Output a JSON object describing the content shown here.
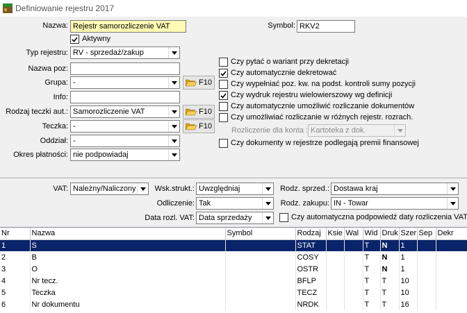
{
  "window": {
    "title": "Definiowanie rejestru 2017"
  },
  "form": {
    "nazwa_label": "Nazwa:",
    "nazwa_value": "Rejestr samorozliczenie VAT",
    "symbol_label": "Symbol:",
    "symbol_value": "RKV2",
    "aktywny_label": "Aktywny",
    "typ_label": "Typ rejestru:",
    "typ_value": "RV - sprzedaż/zakup",
    "nazwa_poz_label": "Nazwa poz:",
    "nazwa_poz_value": "",
    "grupa_label": "Grupa:",
    "grupa_value": "-",
    "info_label": "Info:",
    "info_value": "",
    "rodzaj_teczki_label": "Rodzaj teczki aut.:",
    "rodzaj_teczki_value": "Samorozliczenie VAT",
    "teczka_label": "Teczka:",
    "teczka_value": "-",
    "oddzial_label": "Oddział:",
    "oddzial_value": "-",
    "okres_label": "Okres płatności:",
    "okres_value": "nie podpowiadaj",
    "f10_label": "F10"
  },
  "options": {
    "opt1": "Czy pytać o wariant przy dekretacji",
    "opt2": "Czy automatycznie dekretować",
    "opt3": "Czy wypełniać poz. kw. na podst. kontroli sumy pozycji",
    "opt4": "Czy wydruk rejestru wielowierszowy wg definicji",
    "opt5": "Czy automatycznie umożliwić rozliczanie dokumentów",
    "opt6": "Czy umożliwiać rozliczanie w różnych rejestr. rozrach.",
    "rozliczenie_label": "Rozliczenie dla konta :",
    "rozliczenie_value": "Kartoteka z dok.",
    "opt7": "Czy dokumenty w rejestrze podlegają premii finansowej"
  },
  "vat": {
    "vat_label": "VAT:",
    "vat_value": "Należny/Naliczony",
    "wsk_label": "Wsk.strukt.:",
    "wsk_value": "Uwzględniaj",
    "rodz_sprzed_label": "Rodz. sprzed.:",
    "rodz_sprzed_value": "Dostawa kraj",
    "odliczenie_label": "Odliczenie:",
    "odliczenie_value": "Tak",
    "rodz_zakupu_label": "Rodz. zakupu:",
    "rodz_zakupu_value": "IN - Towar",
    "data_rozl_label": "Data rozl. VAT:",
    "data_rozl_value": "Data sprzedaży",
    "auto_data_label": "Czy automatyczna podpowiedź daty rozliczenia VAT"
  },
  "grid": {
    "headers": [
      "Nr",
      "Nazwa",
      "Symbol",
      "Rodzaj",
      "Ksie",
      "Wal",
      "Wid",
      "Druk",
      "Szer",
      "Sep",
      "Dekr"
    ],
    "rows": [
      [
        "1",
        "S",
        "",
        "STAT",
        "",
        "",
        "T",
        "N",
        "1",
        "",
        ""
      ],
      [
        "2",
        "B",
        "",
        "COSY",
        "",
        "",
        "T",
        "N",
        "1",
        "",
        ""
      ],
      [
        "3",
        "O",
        "",
        "OSTR",
        "",
        "",
        "T",
        "N",
        "1",
        "",
        ""
      ],
      [
        "4",
        "Nr tecz.",
        "",
        "BFLP",
        "",
        "",
        "T",
        "T",
        "10",
        "",
        ""
      ],
      [
        "5",
        "Teczka",
        "",
        "TECZ",
        "",
        "",
        "T",
        "T",
        "10",
        "",
        ""
      ],
      [
        "6",
        "Nr dokumentu",
        "",
        "NRDK",
        "",
        "",
        "T",
        "T",
        "16",
        "",
        ""
      ]
    ]
  }
}
